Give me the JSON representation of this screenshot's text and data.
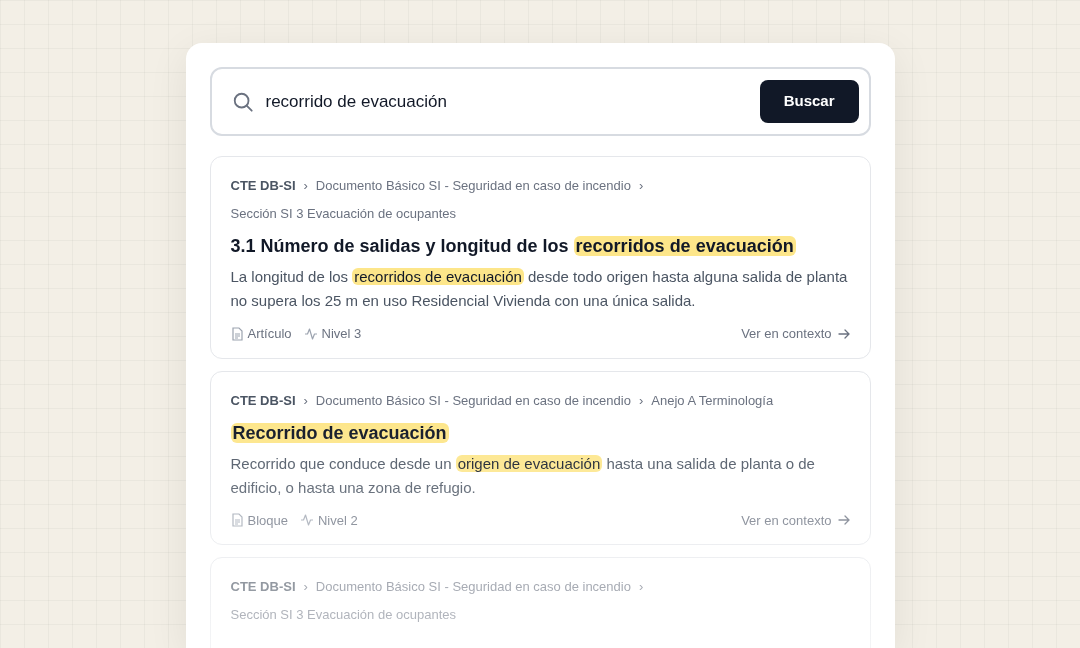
{
  "search": {
    "value": "recorrido de evacuación",
    "button": "Buscar"
  },
  "results": [
    {
      "breadcrumb": [
        {
          "text": "CTE DB-SI",
          "separator": "›"
        },
        {
          "text": "Documento Básico SI - Seguridad en caso de incendio",
          "separator": "›"
        },
        {
          "text": "Sección SI 3 Evacuación de ocupantes"
        }
      ],
      "title": [
        {
          "text": "3.1 Número de salidas y longitud de los ",
          "highlight": false
        },
        {
          "text": "recorridos de evacuación",
          "highlight": true
        }
      ],
      "snippet": [
        {
          "text": "La longitud de los ",
          "highlight": false
        },
        {
          "text": "recorridos de evacuación",
          "highlight": true
        },
        {
          "text": " desde todo origen hasta alguna salida de planta no supera los 25 m en uso Residencial Vivienda con una única salida.",
          "highlight": false
        }
      ],
      "type": "Artículo",
      "level": "Nivel 3",
      "link": "Ver en contexto"
    },
    {
      "breadcrumb": [
        {
          "text": "CTE DB-SI",
          "separator": "›"
        },
        {
          "text": "Documento Básico SI - Seguridad en caso de incendio",
          "separator": "›"
        },
        {
          "text": "Anejo A Terminología"
        }
      ],
      "title": [
        {
          "text": "Recorrido de evacuación",
          "highlight": true
        }
      ],
      "snippet": [
        {
          "text": "Recorrido que conduce desde un ",
          "highlight": false
        },
        {
          "text": "origen de evacuación",
          "highlight": true
        },
        {
          "text": " hasta una salida de planta o de edificio, o hasta una zona de refugio.",
          "highlight": false
        }
      ],
      "type": "Bloque",
      "level": "Nivel 2",
      "link": "Ver en contexto"
    },
    {
      "breadcrumb": [
        {
          "text": "CTE DB-SI",
          "separator": "›"
        },
        {
          "text": "Documento Básico SI - Seguridad en caso de incendio",
          "separator": "›"
        },
        {
          "text": "Sección SI 3 Evacuación de ocupantes"
        }
      ]
    }
  ]
}
